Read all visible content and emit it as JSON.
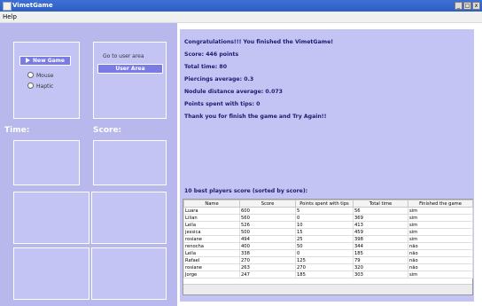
{
  "window": {
    "title": "VimetGame",
    "minimize": "_",
    "maximize": "□",
    "close": "x"
  },
  "menubar": {
    "help": "Help"
  },
  "left": {
    "new_game": "New Game",
    "radio_mouse": "Mouse",
    "radio_haptic": "Haptic",
    "goto_label": "Go to user area",
    "user_area": "User Area",
    "time_label": "Time:",
    "score_label": "Score:"
  },
  "results": {
    "congrats": "Congratulations!!! You finished the VimetGame!",
    "score": "Score: 446 points",
    "total_time": "Total time: 80",
    "piercings": "Piercings average: 0.3",
    "nodule": "Nodule distance average: 0.073",
    "tips": "Points spent with tips: 0",
    "thanks": "Thank you for finish the game and Try Again!!"
  },
  "best": {
    "title": "10 best players score (sorted by score):",
    "columns": [
      "Name",
      "Score",
      "Points spent with tips",
      "Total time",
      "Finished the game"
    ],
    "rows": [
      [
        "Luara",
        "600",
        "5",
        "56",
        "sim"
      ],
      [
        "Lilian",
        "560",
        "0",
        "369",
        "sim"
      ],
      [
        "Leila",
        "526",
        "10",
        "413",
        "sim"
      ],
      [
        "jessica",
        "500",
        "15",
        "459",
        "sim"
      ],
      [
        "rosiane",
        "494",
        "25",
        "398",
        "sim"
      ],
      [
        "renocha",
        "400",
        "50",
        "344",
        "não"
      ],
      [
        "Leila",
        "338",
        "0",
        "185",
        "não"
      ],
      [
        "Rafael",
        "270",
        "125",
        "79",
        "não"
      ],
      [
        "rosiane",
        "263",
        "270",
        "320",
        "não"
      ],
      [
        "Jorge",
        "247",
        "185",
        "303",
        "sim"
      ]
    ]
  }
}
